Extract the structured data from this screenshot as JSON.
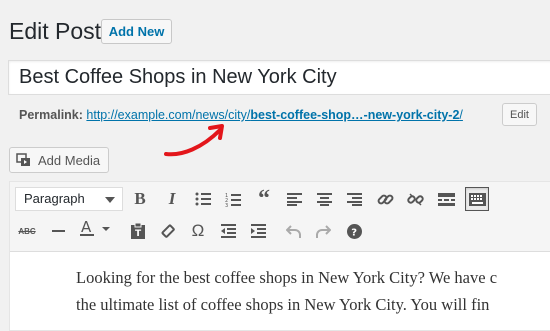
{
  "header": {
    "title": "Edit Post",
    "add_new_label": "Add New"
  },
  "post": {
    "title": "Best Coffee Shops in New York City",
    "permalink_label": "Permalink:",
    "permalink_prefix": "http://example.com/news/city/",
    "permalink_slug": "best-coffee-shop…-new-york-city-2",
    "permalink_suffix": "/",
    "edit_label": "Edit"
  },
  "media": {
    "add_media_label": "Add Media",
    "icon": "media-icon"
  },
  "toolbar": {
    "format_select": "Paragraph",
    "row1_icons": [
      "bold-icon",
      "italic-icon",
      "bullet-list-icon",
      "numbered-list-icon",
      "blockquote-icon",
      "align-left-icon",
      "align-center-icon",
      "align-right-icon",
      "link-icon",
      "unlink-icon",
      "read-more-icon",
      "toolbar-toggle-icon"
    ],
    "row2_icons": [
      "strikethrough-icon",
      "horizontal-line-icon",
      "text-color-icon",
      "paste-text-icon",
      "clear-formatting-icon",
      "special-character-icon",
      "outdent-icon",
      "indent-icon",
      "undo-icon",
      "redo-icon",
      "help-icon"
    ]
  },
  "content": {
    "line1": "Looking for the best coffee shops in New York City? We have c",
    "line2": "the ultimate list of coffee shops in New York City. You will fin"
  },
  "colors": {
    "link": "#0073aa",
    "annotation_arrow": "#e3161b"
  }
}
